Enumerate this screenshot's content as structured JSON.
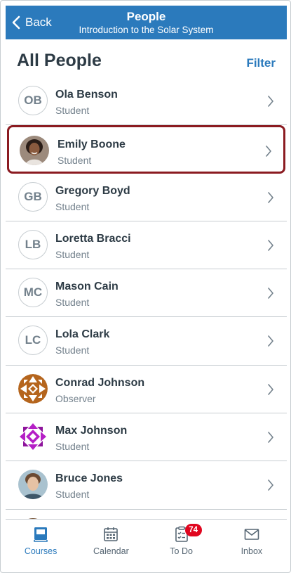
{
  "header": {
    "back_label": "Back",
    "title": "People",
    "subtitle": "Introduction to the Solar System",
    "background": "#2b7abc"
  },
  "page": {
    "title": "All People",
    "filter_label": "Filter"
  },
  "people": [
    {
      "name": "Ola Benson",
      "role": "Student",
      "initials": "OB",
      "avatar": "initials"
    },
    {
      "name": "Emily Boone",
      "role": "Student",
      "initials": "",
      "avatar": "photo",
      "highlighted": true
    },
    {
      "name": "Gregory Boyd",
      "role": "Student",
      "initials": "GB",
      "avatar": "initials"
    },
    {
      "name": "Loretta Bracci",
      "role": "Student",
      "initials": "LB",
      "avatar": "initials"
    },
    {
      "name": "Mason Cain",
      "role": "Student",
      "initials": "MC",
      "avatar": "initials"
    },
    {
      "name": "Lola Clark",
      "role": "Student",
      "initials": "LC",
      "avatar": "initials"
    },
    {
      "name": "Conrad Johnson",
      "role": "Observer",
      "initials": "",
      "avatar": "pattern-brown"
    },
    {
      "name": "Max Johnson",
      "role": "Student",
      "initials": "",
      "avatar": "pattern-purple"
    },
    {
      "name": "Bruce Jones",
      "role": "Student",
      "initials": "",
      "avatar": "photo"
    }
  ],
  "tabs": [
    {
      "label": "Courses",
      "icon": "courses-icon",
      "active": true
    },
    {
      "label": "Calendar",
      "icon": "calendar-icon"
    },
    {
      "label": "To Do",
      "icon": "todo-icon",
      "badge": "74"
    },
    {
      "label": "Inbox",
      "icon": "inbox-icon"
    }
  ],
  "colors": {
    "accent": "#2b7abc",
    "highlight_border": "#8b1b21",
    "badge": "#e0061f"
  }
}
